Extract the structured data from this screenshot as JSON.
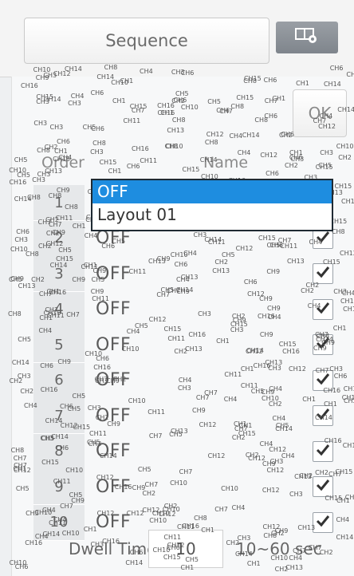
{
  "header": {
    "sequence_label": "Sequence",
    "settings_icon": "layout-settings-icon"
  },
  "ok_label": "OK",
  "table": {
    "order_header": "Order",
    "name_header": "Name",
    "rows": [
      {
        "order": "1",
        "name": "OFF",
        "checked": false
      },
      {
        "order": "2",
        "name": "OFF",
        "checked": true
      },
      {
        "order": "3",
        "name": "OFF",
        "checked": true
      },
      {
        "order": "4",
        "name": "OFF",
        "checked": true
      },
      {
        "order": "5",
        "name": "OFF",
        "checked": true
      },
      {
        "order": "6",
        "name": "OFF",
        "checked": true
      },
      {
        "order": "7",
        "name": "OFF",
        "checked": true
      },
      {
        "order": "8",
        "name": "OFF",
        "checked": true
      },
      {
        "order": "9",
        "name": "OFF",
        "checked": true
      },
      {
        "order": "10",
        "name": "OFF",
        "checked": true
      }
    ]
  },
  "dropdown": {
    "options": [
      "OFF",
      "Layout 01"
    ],
    "selected": "OFF"
  },
  "dwell": {
    "label": "Dwell Time",
    "value": "10",
    "range": "10~60 sec"
  },
  "overlay_labels": {
    "channels": [
      "CH1",
      "CH2",
      "CH3",
      "CH4",
      "CH5",
      "CH6",
      "CH7",
      "CH8",
      "CH9",
      "CH10",
      "CH11",
      "CH12",
      "CH13",
      "CH14",
      "CH15",
      "CH16"
    ]
  },
  "colors": {
    "accent": "#1e8de0",
    "settings_button": "#878d94"
  }
}
